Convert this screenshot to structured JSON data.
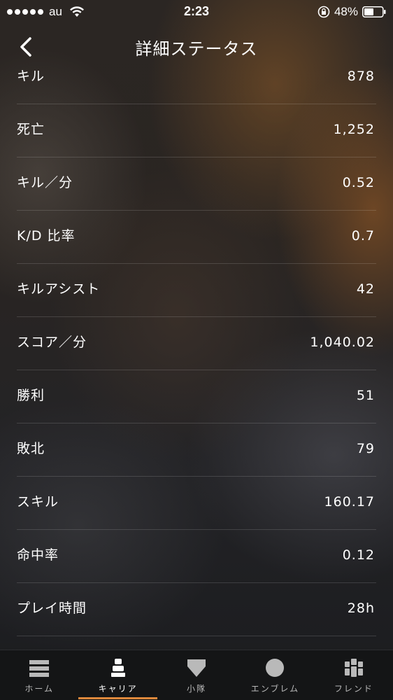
{
  "status_bar": {
    "carrier": "au",
    "time": "2:23",
    "battery": "48%"
  },
  "nav": {
    "title": "詳細ステータス"
  },
  "stats": [
    {
      "label": "キル",
      "value": "878"
    },
    {
      "label": "死亡",
      "value": "1,252"
    },
    {
      "label": "キル／分",
      "value": "0.52"
    },
    {
      "label": "K/D 比率",
      "value": "0.7"
    },
    {
      "label": "キルアシスト",
      "value": "42"
    },
    {
      "label": "スコア／分",
      "value": "1,040.02"
    },
    {
      "label": "勝利",
      "value": "51"
    },
    {
      "label": "敗北",
      "value": "79"
    },
    {
      "label": "スキル",
      "value": "160.17"
    },
    {
      "label": "命中率",
      "value": "0.12"
    },
    {
      "label": "プレイ時間",
      "value": "28h"
    }
  ],
  "tabs": [
    {
      "label": "ホーム",
      "icon": "home-icon"
    },
    {
      "label": "キャリア",
      "icon": "soldier-icon",
      "active": true
    },
    {
      "label": "小隊",
      "icon": "shield-icon"
    },
    {
      "label": "エンブレム",
      "icon": "emblem-icon"
    },
    {
      "label": "フレンド",
      "icon": "friends-icon"
    }
  ],
  "colors": {
    "accent": "#e0893c",
    "tab_background": "#141516"
  }
}
